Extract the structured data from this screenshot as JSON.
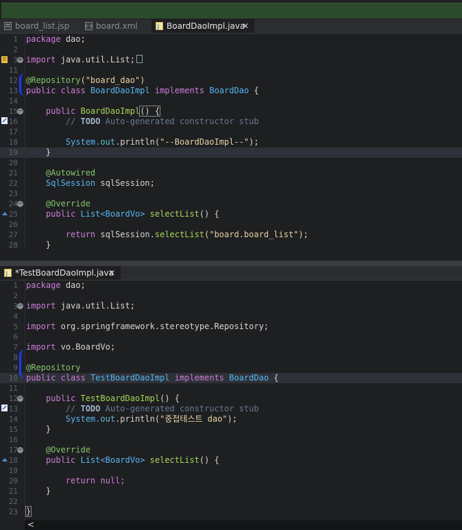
{
  "top_tabs": [
    {
      "label": "board_list.jsp",
      "active": false
    },
    {
      "label": "board.xml",
      "active": false
    },
    {
      "label": "BoardDaoImpl.java",
      "active": true
    }
  ],
  "top_editor": {
    "line_numbers": [
      "1",
      "2",
      "3",
      "11",
      "12",
      "13",
      "14",
      "15",
      "16",
      "17",
      "18",
      "19",
      "20",
      "21",
      "22",
      "23",
      "24",
      "25",
      "26",
      "27",
      "28"
    ],
    "package_kw": "package",
    "package_name": "dao;",
    "import_kw": "import",
    "import_value": "java.util.List;",
    "annotation_repo": "@Repository",
    "repo_arg": "(\"board_dao\")",
    "class_mods": "public class",
    "class_name": "BoardDaoImpl",
    "implements_kw": "implements",
    "interface_name": "BoardDao",
    "brace_open": "{",
    "ctor_kw": "public",
    "ctor_name": "BoardDaoImpl",
    "ctor_rest": "() {",
    "comment_prefix": "//",
    "todo": "TODO",
    "todo_text": "Auto-generated constructor stub",
    "system": "System.",
    "out": "out",
    "println": ".println(",
    "println_str": "\"--BoardDaoImpl--\"",
    "println_end": ");",
    "close_brace": "}",
    "autowired": "@Autowired",
    "field_type": "SqlSession",
    "field_name": "sqlSession;",
    "override": "@Override",
    "method_public": "public",
    "method_type": "List<BoardVo>",
    "method_name": "selectList",
    "method_rest": "() {",
    "return_kw": "return",
    "return_obj": "sqlSession.",
    "return_call": "selectList",
    "return_arg": "(\"board.board_list\");",
    "scroll_arrow": "<"
  },
  "bottom_tab": {
    "label": "*TestBoardDaoImpl.java"
  },
  "bottom_editor": {
    "line_numbers": [
      "1",
      "2",
      "3",
      "4",
      "5",
      "6",
      "7",
      "8",
      "9",
      "10",
      "11",
      "12",
      "13",
      "14",
      "15",
      "16",
      "17",
      "18",
      "19",
      "20",
      "21",
      "22",
      "23"
    ],
    "package_kw": "package",
    "package_name": "dao;",
    "import_kw": "import",
    "import1": "java.util.List;",
    "import2": "org.springframework.stereotype.Repository;",
    "import3": "vo.BoardVo;",
    "annotation_repo": "@Repository",
    "class_mods": "public class",
    "class_name": "TestBoardDaoImpl",
    "implements_kw": "implements",
    "interface_name": "BoardDao",
    "brace_open": "{",
    "ctor_kw": "public",
    "ctor_name": "TestBoardDaoImpl",
    "ctor_rest": "() {",
    "comment_prefix": "//",
    "todo": "TODO",
    "todo_text": "Auto-generated constructor stub",
    "system": "System.",
    "out": "out",
    "println": ".println(",
    "println_str": "\"중첩테스트 dao\"",
    "println_end": ");",
    "close_brace": "}",
    "override": "@Override",
    "method_public": "public",
    "method_type": "List<BoardVo>",
    "method_name": "selectList",
    "method_rest": "() {",
    "return_kw": "return",
    "return_val": "null;",
    "final_brace": "}",
    "scroll_arrow": "<"
  },
  "colors": {
    "keyword": "#cc7dda",
    "class": "#56b6f0",
    "annotation": "#84c66b",
    "string": "#e6d3a3",
    "comment": "#6a7a8f",
    "marker_blue": "#1b3bff"
  }
}
